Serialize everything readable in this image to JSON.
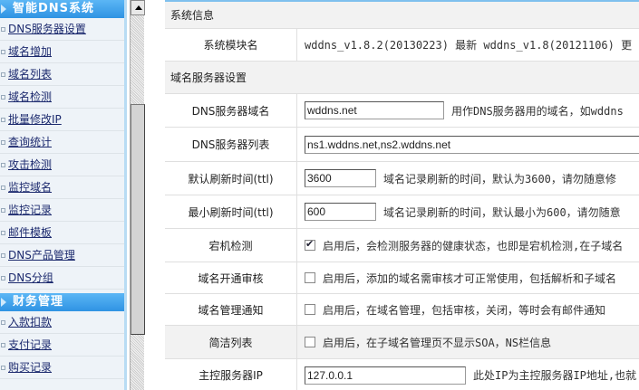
{
  "sidebar": {
    "section1": "智能DNS系统",
    "items1": [
      "DNS服务器设置",
      "域名增加",
      "域名列表",
      "域名检测",
      "批量修改IP",
      "查询统计",
      "攻击检测",
      "监控域名",
      "监控记录",
      "邮件模板",
      "DNS产品管理",
      "DNS分组"
    ],
    "section2": "财务管理",
    "items2": [
      "入款扣款",
      "支付记录",
      "购买记录"
    ]
  },
  "main": {
    "sys_info": "系统信息",
    "module_label": "系统模块名",
    "module_value": "wddns_v1.8.2(20130223) 最新 wddns_v1.8(20121106) 更",
    "ns_section": "域名服务器设置",
    "rows": [
      {
        "label": "DNS服务器域名",
        "value": "wddns.net",
        "hint": "用作DNS服务器用的域名，如wddns"
      },
      {
        "label": "DNS服务器列表",
        "value": "ns1.wddns.net,ns2.wddns.net"
      },
      {
        "label": "默认刷新时间(ttl)",
        "value": "3600",
        "hint": "域名记录刷新的时间，默认为3600，请勿随意修"
      },
      {
        "label": "最小刷新时间(ttl)",
        "value": "600",
        "hint": "域名记录刷新的时间，默认最小为600，请勿随意"
      },
      {
        "label": "宕机检测",
        "hint": "启用后，会检测服务器的健康状态，也即是宕机检测,在子域名"
      },
      {
        "label": "域名开通审核",
        "hint": "启用后，添加的域名需审核才可正常使用，包括解析和子域名"
      },
      {
        "label": "域名管理通知",
        "hint": "启用后，在域名管理，包括审核，关闭，等时会有邮件通知"
      },
      {
        "label": "简洁列表",
        "hint": "启用后，在子域名管理页不显示SOA，NS栏信息"
      },
      {
        "label": "主控服务器IP",
        "value": "127.0.0.1",
        "hint": "此处IP为主控服务器IP地址,也就"
      }
    ]
  }
}
